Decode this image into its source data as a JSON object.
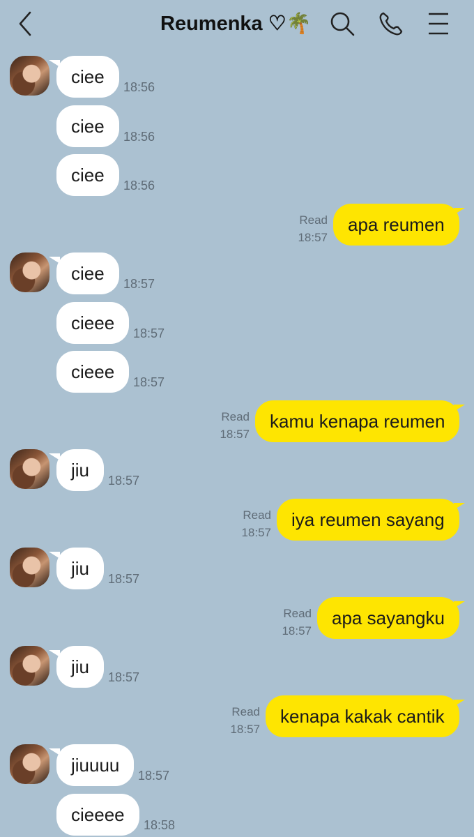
{
  "header": {
    "title": "Reumenka ♡🌴",
    "icons": [
      "back-chevron-icon",
      "search-icon",
      "phone-icon",
      "menu-icon"
    ]
  },
  "colors": {
    "background": "#abc1d1",
    "incoming": "#ffffff",
    "outgoing": "#fee501"
  },
  "messages": [
    {
      "dir": "in",
      "text": "ciee",
      "time": "18:56",
      "avatar": true
    },
    {
      "dir": "in",
      "text": "ciee",
      "time": "18:56"
    },
    {
      "dir": "in",
      "text": "ciee",
      "time": "18:56"
    },
    {
      "dir": "out",
      "text": "apa reumen",
      "status": "Read",
      "time": "18:57"
    },
    {
      "dir": "in",
      "text": "ciee",
      "time": "18:57",
      "avatar": true
    },
    {
      "dir": "in",
      "text": "cieee",
      "time": "18:57"
    },
    {
      "dir": "in",
      "text": "cieee",
      "time": "18:57"
    },
    {
      "dir": "out",
      "text": "kamu kenapa reumen",
      "status": "Read",
      "time": "18:57"
    },
    {
      "dir": "in",
      "text": "jiu",
      "time": "18:57",
      "avatar": true
    },
    {
      "dir": "out",
      "text": "iya reumen sayang",
      "status": "Read",
      "time": "18:57"
    },
    {
      "dir": "in",
      "text": "jiu",
      "time": "18:57",
      "avatar": true
    },
    {
      "dir": "out",
      "text": "apa sayangku",
      "status": "Read",
      "time": "18:57"
    },
    {
      "dir": "in",
      "text": "jiu",
      "time": "18:57",
      "avatar": true
    },
    {
      "dir": "out",
      "text": "kenapa kakak cantik",
      "status": "Read",
      "time": "18:57"
    },
    {
      "dir": "in",
      "text": "jiuuuu",
      "time": "18:57",
      "avatar": true
    },
    {
      "dir": "in",
      "text": "cieeee",
      "time": "18:58"
    }
  ]
}
